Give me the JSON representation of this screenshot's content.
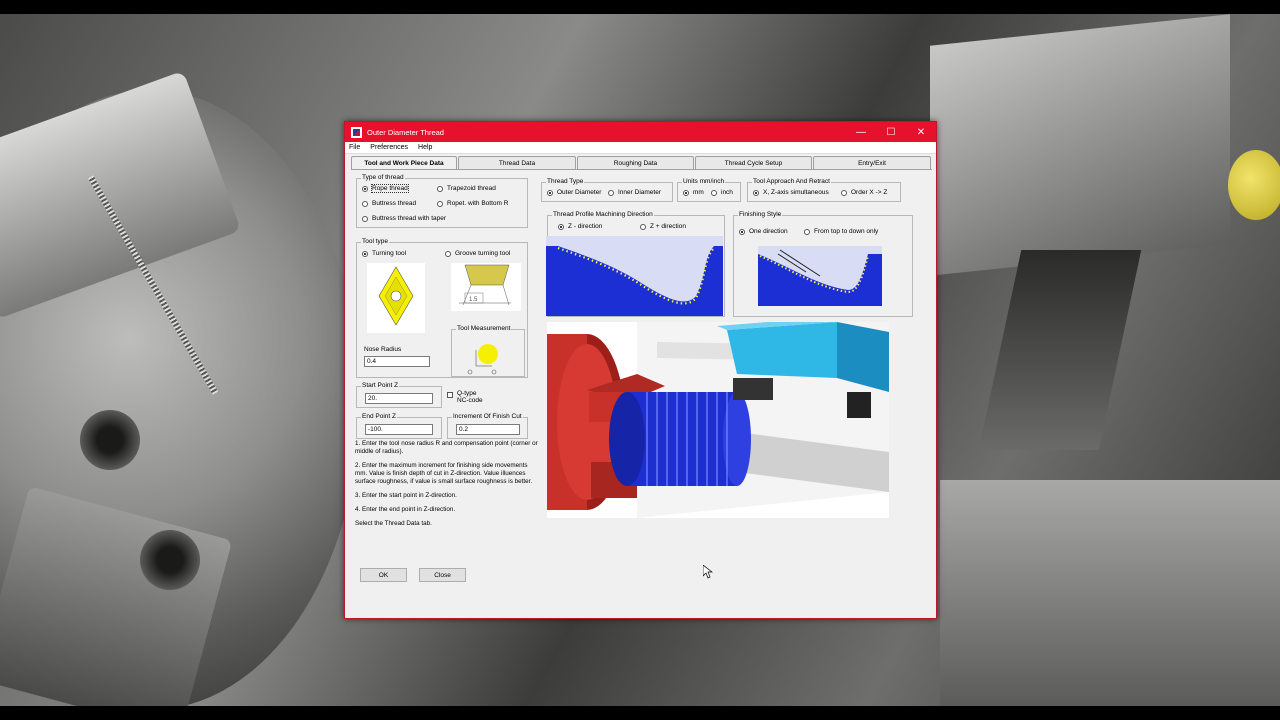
{
  "window": {
    "title": "Outer Diameter Thread",
    "controls": {
      "minimize": "—",
      "maximize": "☐",
      "close": "✕"
    }
  },
  "menu": {
    "file": "File",
    "preferences": "Preferences",
    "help": "Help"
  },
  "tabs": [
    {
      "label": "Tool and Work Piece Data"
    },
    {
      "label": "Thread Data"
    },
    {
      "label": "Roughing Data"
    },
    {
      "label": "Thread Cycle Setup"
    },
    {
      "label": "Entry/Exit"
    }
  ],
  "type_of_thread": {
    "label": "Type of thread",
    "options": [
      "Rope thread",
      "Trapezoid thread",
      "Buttress thread",
      "Ropet. with Bottom R",
      "Buttress thread with taper"
    ],
    "selected": "Rope thread"
  },
  "tool_type": {
    "label": "Tool type",
    "options": [
      "Turning tool",
      "Groove turning tool"
    ],
    "selected": "Turning tool",
    "groove_dim": "1.5",
    "nose_radius_label": "Nose Radius",
    "nose_radius_value": "0.4",
    "tool_measurement_label": "Tool Measurement"
  },
  "start_point": {
    "label": "Start Point Z",
    "value": "20."
  },
  "end_point": {
    "label": "End Point Z",
    "value": "-100."
  },
  "increment_finish": {
    "label": "Increment Of Finish Cut",
    "value": "0.2"
  },
  "qtype": {
    "label": "Q-type\nNC-code",
    "line1": "Q-type",
    "line2": "NC-code",
    "checked": false
  },
  "help_text": [
    "1. Enter the tool nose radius R and compensation point (corner or middle of radius).",
    "2. Enter the maximum increment for finishing side movements mm. Value is finish depth of cut in Z-direction. Value illuences surface roughness, if value is small surface roughness is better.",
    "3. Enter the start point in Z-direction.",
    "4. Enter the end point in Z-direction.",
    "Select the Thread Data tab."
  ],
  "buttons": {
    "ok": "OK",
    "close": "Close"
  },
  "thread_type": {
    "label": "Thread Type",
    "options": [
      "Outer Diameter",
      "Inner Diameter"
    ],
    "selected": "Outer Diameter"
  },
  "units": {
    "label": "Units mm/inch",
    "options": [
      "mm",
      "inch"
    ],
    "selected": "mm"
  },
  "tool_approach": {
    "label": "Tool Approach And Retract",
    "options": [
      "X, Z-axis simultaneous",
      "Order X -> Z"
    ],
    "selected": "X, Z-axis simultaneous"
  },
  "profile_direction": {
    "label": "Thread Profile Machining Direction",
    "options": [
      "Z - direction",
      "Z + direction"
    ],
    "selected": "Z - direction"
  },
  "finishing_style": {
    "label": "Finishing Style",
    "options": [
      "One direction",
      "From top to down only"
    ],
    "selected": "One direction"
  },
  "colors": {
    "titlebar": "#e8112d",
    "profile_bg": "#1b2fd4",
    "profile_dots": "#f2ef5a",
    "insert": "#f5f000",
    "workpiece_red": "#c8302a",
    "workpiece_blue": "#1e2fd0",
    "tool_cyan": "#2fb7e6"
  }
}
